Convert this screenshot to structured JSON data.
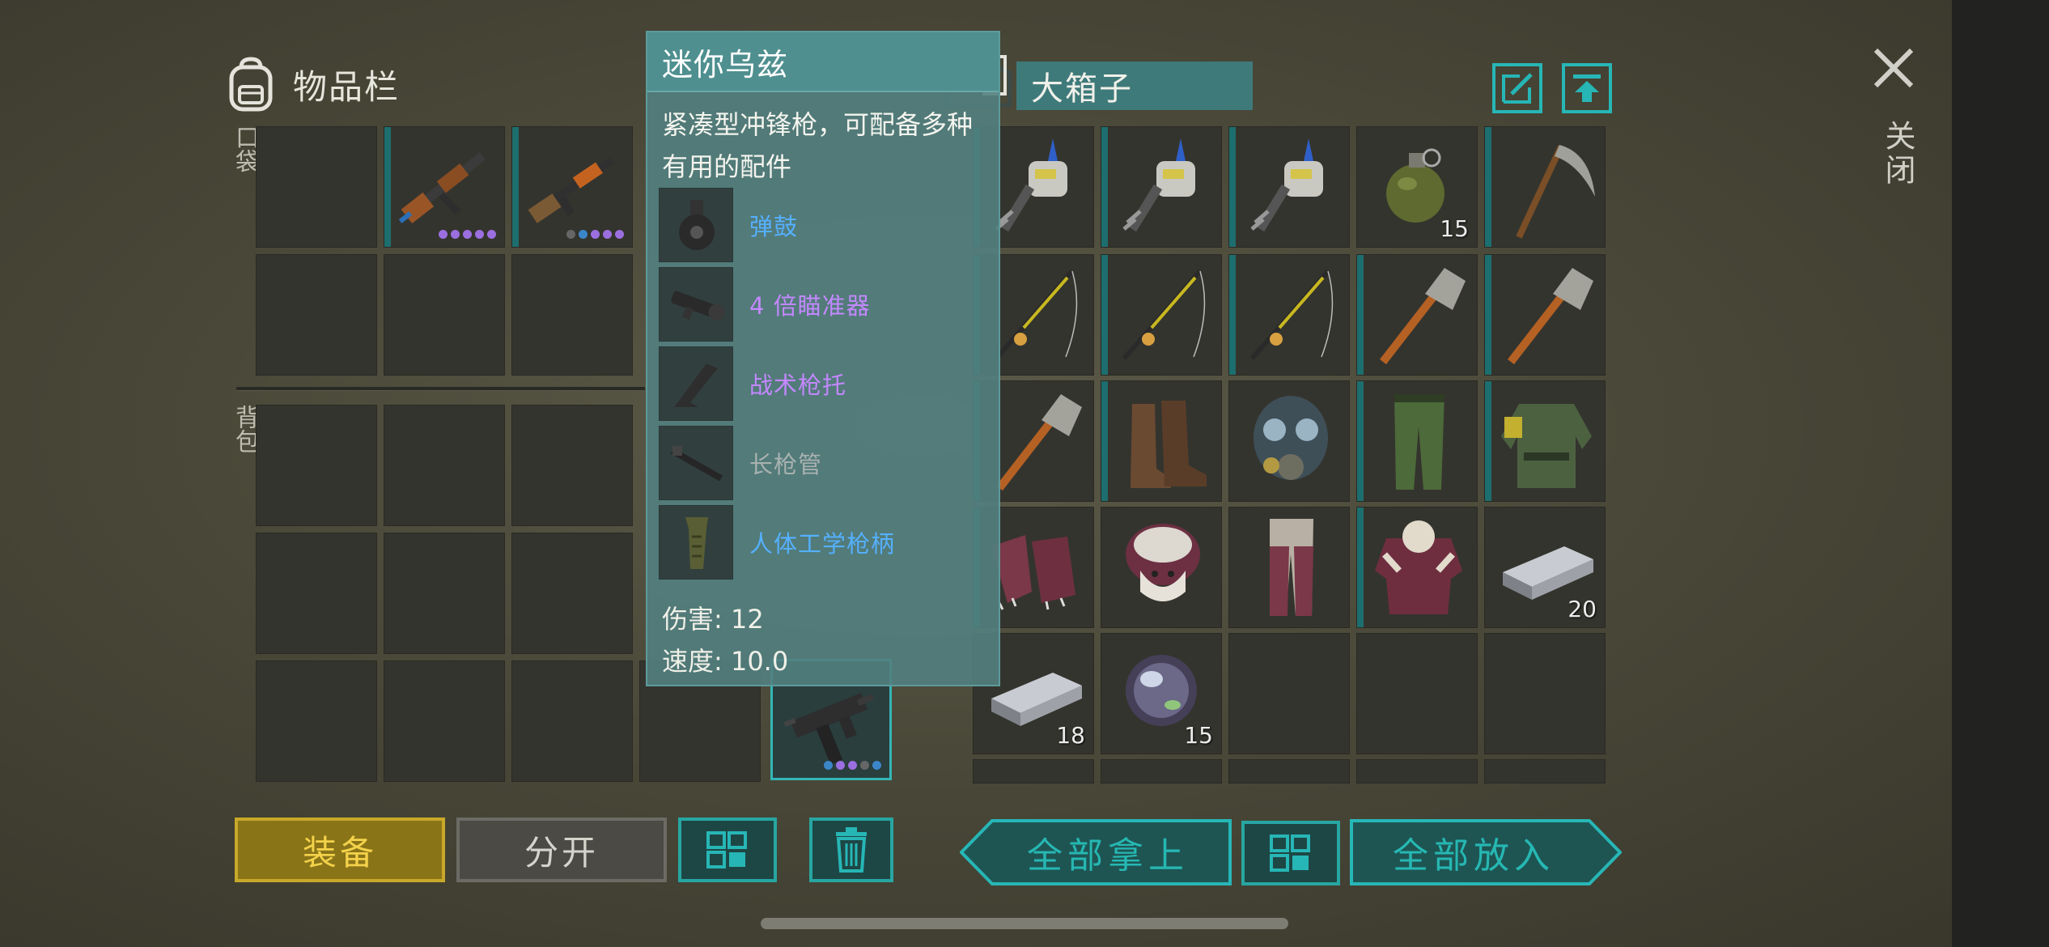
{
  "inventory": {
    "title": "物品栏",
    "pocket_label": "口袋",
    "backpack_label": "背包"
  },
  "chest": {
    "name": "大箱子",
    "close_label": "关闭",
    "item_quantities": {
      "grenade": "15",
      "iron_bar_1": "20",
      "iron_bar_2": "18",
      "lens": "15"
    }
  },
  "tooltip": {
    "title": "迷你乌兹",
    "description": "紧凑型冲锋枪，可配备多种有用的配件",
    "attachments": [
      {
        "label": "弹鼓",
        "icon": "drum-magazine-icon"
      },
      {
        "label": "4 倍瞄准器",
        "icon": "scope-icon"
      },
      {
        "label": "战术枪托",
        "icon": "stock-icon"
      },
      {
        "label": "长枪管",
        "icon": "barrel-icon"
      },
      {
        "label": "人体工学枪柄",
        "icon": "grip-icon"
      }
    ],
    "damage": "伤害: 12",
    "speed": "速度: 10.0"
  },
  "buttons": {
    "equip": "装备",
    "split": "分开",
    "take_all": "全部拿上",
    "put_all": "全部放入"
  },
  "colors": {
    "accent_teal": "#27b6b6",
    "equip_gold": "#c8a82a",
    "rarity_purple": "#9b6fe0",
    "rarity_blue": "#55b0ff"
  }
}
